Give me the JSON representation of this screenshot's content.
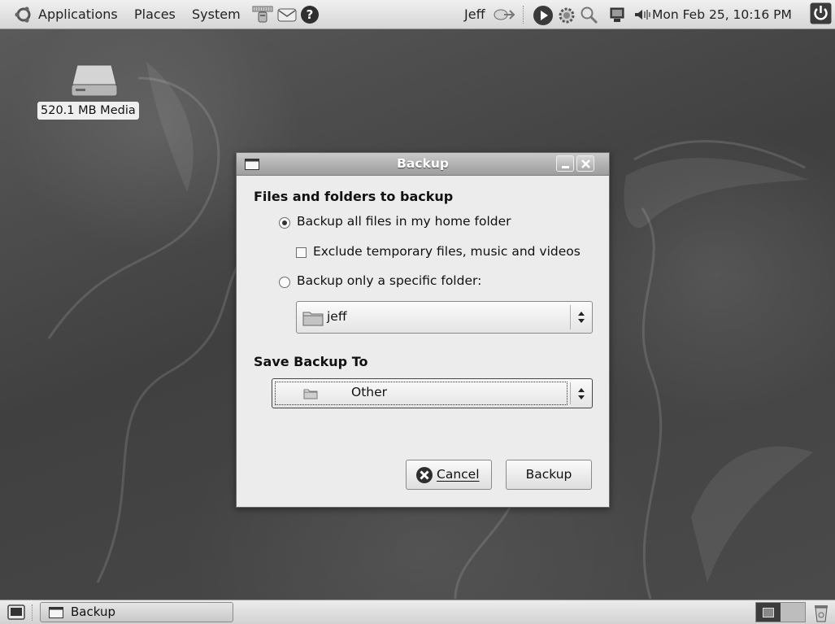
{
  "top_panel": {
    "applications": "Applications",
    "places": "Places",
    "system": "System",
    "user": "Jeff",
    "datetime": "Mon Feb 25, 10:16 PM"
  },
  "desktop": {
    "drive_label": "520.1 MB Media"
  },
  "dialog": {
    "title": "Backup",
    "section1_title": "Files and folders to backup",
    "option_home": "Backup all files in my home folder",
    "option_home_selected": true,
    "exclude_label": "Exclude temporary files, music and videos",
    "exclude_checked": false,
    "option_specific": "Backup only a specific folder:",
    "folder_value": "jeff",
    "section2_title": "Save Backup To",
    "save_to_value": "Other",
    "cancel_label": "Cancel",
    "backup_label": "Backup"
  },
  "bottom_panel": {
    "task_label": "Backup"
  },
  "icons": [
    "ubuntu-logo-icon",
    "network-icon",
    "mail-icon",
    "help-icon",
    "user-switch-icon",
    "media-play-icon",
    "gear-icon",
    "search-icon",
    "monitor-icon",
    "volume-icon",
    "power-icon",
    "drive-icon",
    "folder-icon",
    "cancel-icon",
    "show-desktop-icon",
    "window-icon",
    "workspace-icon",
    "trash-icon"
  ]
}
